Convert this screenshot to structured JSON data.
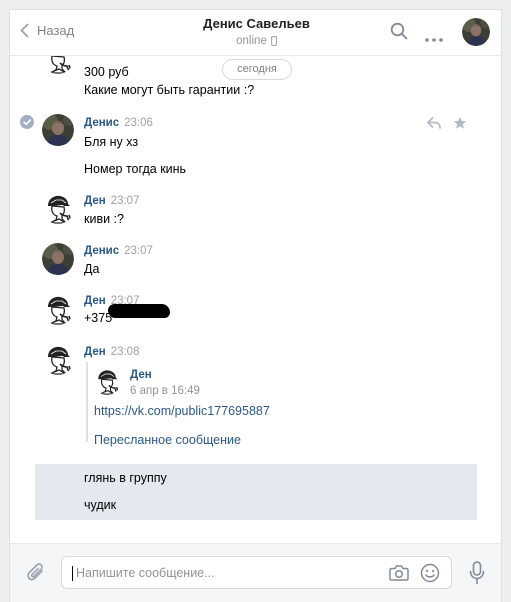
{
  "header": {
    "back_label": "Назад",
    "contact_name": "Денис Савельев",
    "status": "online"
  },
  "date_divider": "сегодня",
  "messages": [
    {
      "name": "",
      "time": "",
      "lines": [
        "300 руб",
        "Какие могут быть гарантии :?"
      ]
    },
    {
      "name": "Денис",
      "time": "23:06",
      "lines": [
        "Бля ну хз",
        "Номер тогда кинь"
      ]
    },
    {
      "name": "Ден",
      "time": "23:07",
      "lines": [
        "киви :?"
      ]
    },
    {
      "name": "Денис",
      "time": "23:07",
      "lines": [
        "Да"
      ]
    },
    {
      "name": "Ден",
      "time": "23:07",
      "lines": [
        "+375"
      ]
    },
    {
      "name": "Ден",
      "time": "23:08",
      "lines": []
    }
  ],
  "forwarded": {
    "name": "Ден",
    "date": "6 апр в 16:49",
    "link": "https://vk.com/public177695887",
    "label": "Пересланное сообщение"
  },
  "selected": {
    "lines": [
      "глянь в группу",
      "чудик"
    ]
  },
  "composer": {
    "placeholder": "Напишите сообщение..."
  },
  "colors": {
    "link": "#2a5885",
    "selection": "#e4e9ef",
    "muted": "#a0a0a0"
  },
  "icons": [
    "back-arrow-icon",
    "search-icon",
    "more-icon",
    "phone-icon",
    "check-icon",
    "reply-icon",
    "star-icon",
    "paperclip-icon",
    "camera-icon",
    "smile-icon",
    "microphone-icon"
  ]
}
